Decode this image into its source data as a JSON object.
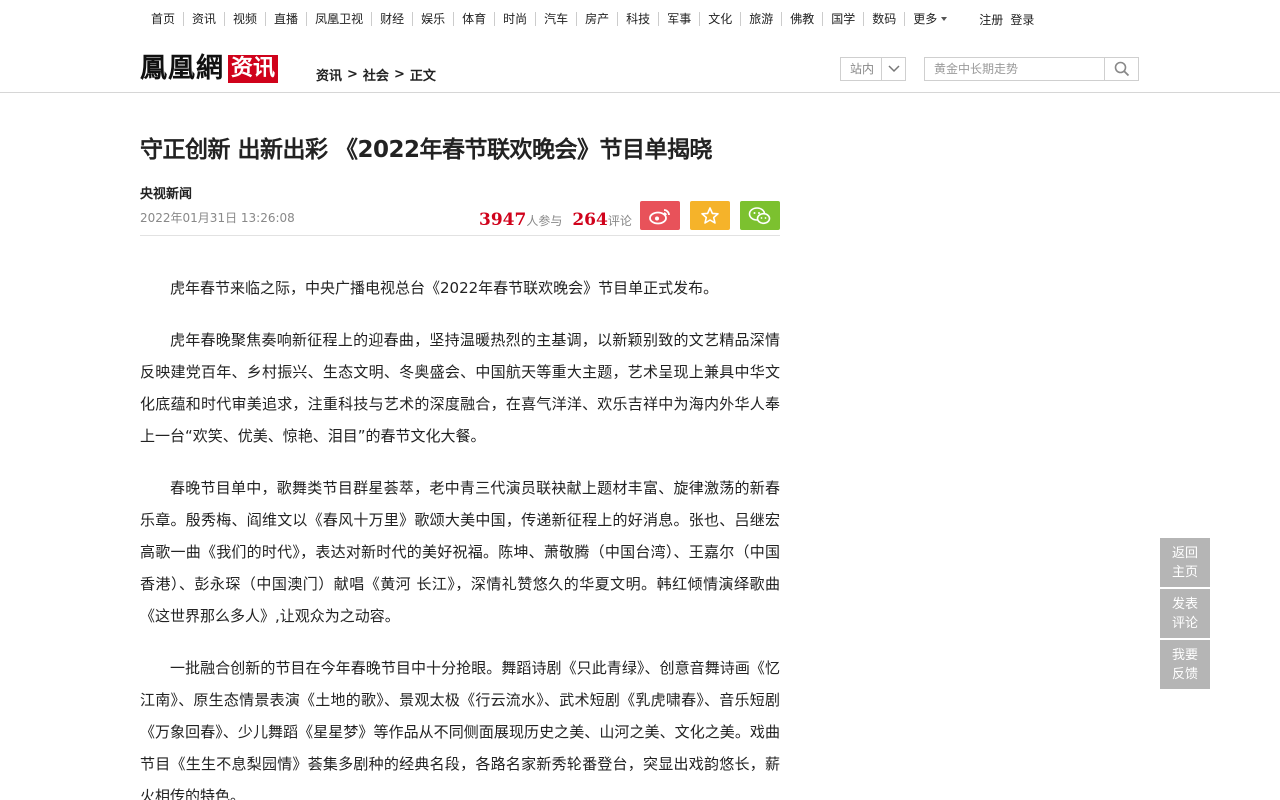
{
  "topnav": {
    "items": [
      "首页",
      "资讯",
      "视频",
      "直播",
      "凤凰卫视",
      "财经",
      "娱乐",
      "体育",
      "时尚",
      "汽车",
      "房产",
      "科技",
      "军事",
      "文化",
      "旅游",
      "佛教",
      "国学",
      "数码"
    ],
    "more": "更多",
    "register": "注册",
    "login": "登录"
  },
  "header": {
    "logo_main": "鳳凰網",
    "logo_channel": "资讯",
    "breadcrumb": [
      "资讯",
      "社会",
      "正文"
    ],
    "breadcrumb_sep": ">",
    "site_select": "站内",
    "search_placeholder": "黄金中长期走势"
  },
  "article": {
    "title": "守正创新 出新出彩 《2022年春节联欢晚会》节目单揭晓",
    "source": "央视新闻",
    "time": "2022年01月31日 13:26:08",
    "participants": "3947",
    "participants_unit": "人参与",
    "comments": "264",
    "comments_unit": "评论",
    "paragraphs": [
      "虎年春节来临之际，中央广播电视总台《2022年春节联欢晚会》节目单正式发布。",
      "虎年春晚聚焦奏响新征程上的迎春曲，坚持温暖热烈的主基调，以新颖别致的文艺精品深情反映建党百年、乡村振兴、生态文明、冬奥盛会、中国航天等重大主题，艺术呈现上兼具中华文化底蕴和时代审美追求，注重科技与艺术的深度融合，在喜气洋洋、欢乐吉祥中为海内外华人奉上一台“欢笑、优美、惊艳、泪目”的春节文化大餐。",
      "春晚节目单中，歌舞类节目群星荟萃，老中青三代演员联袂献上题材丰富、旋律激荡的新春乐章。殷秀梅、阎维文以《春风十万里》歌颂大美中国，传递新征程上的好消息。张也、吕继宏高歌一曲《我们的时代》，表达对新时代的美好祝福。陈坤、萧敬腾（中国台湾）、王嘉尔（中国香港）、彭永琛（中国澳门）献唱《黄河 长江》，深情礼赞悠久的华夏文明。韩红倾情演绎歌曲《这世界那么多人》,让观众为之动容。",
      "一批融合创新的节目在今年春晚节目中十分抢眼。舞蹈诗剧《只此青绿》、创意音舞诗画《忆江南》、原生态情景表演《土地的歌》、景观太极《行云流水》、武术短剧《乳虎啸春》、音乐短剧《万象回春》、少儿舞蹈《星星梦》等作品从不同侧面展现历史之美、山河之美、文化之美。戏曲节目《生生不息梨园情》荟集多剧种的经典名段，各路名家新秀轮番登台，突显出戏韵悠长，薪火相传的特色。"
    ]
  },
  "side": {
    "home": "返回\n主页",
    "comment": "发表\n评论",
    "feedback": "我要\n反馈"
  },
  "colors": {
    "brand_red": "#d0021b",
    "weibo": "#e8525a",
    "favorite": "#f5b32a",
    "wechat": "#7cc12f"
  },
  "icons": {
    "weibo": "weibo-icon",
    "favorite": "star-icon",
    "wechat": "wechat-icon",
    "search": "search-icon",
    "select": "chevron-down-icon"
  }
}
